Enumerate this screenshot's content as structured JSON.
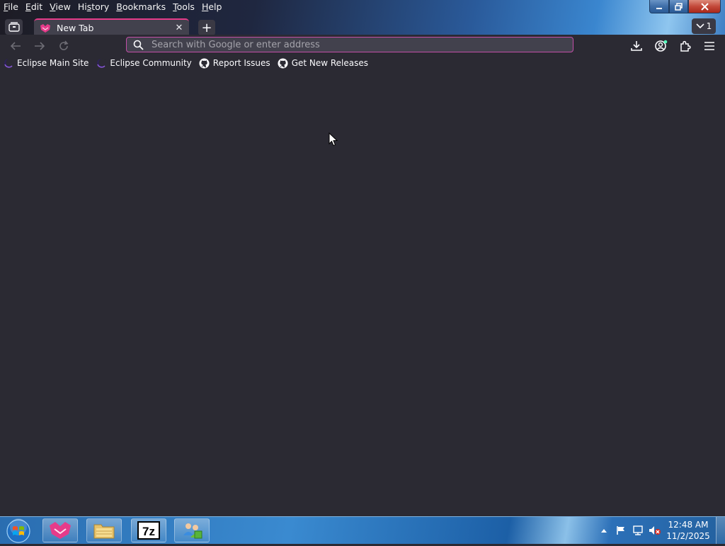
{
  "menubar": {
    "items": [
      {
        "accel": "F",
        "rest": "ile"
      },
      {
        "accel": "E",
        "rest": "dit"
      },
      {
        "accel": "V",
        "rest": "iew"
      },
      {
        "accel": "",
        "pre": "Hi",
        "accel2": "s",
        "rest": "tory"
      },
      {
        "accel": "B",
        "rest": "ookmarks"
      },
      {
        "accel": "T",
        "rest": "ools"
      },
      {
        "accel": "H",
        "rest": "elp"
      }
    ]
  },
  "window_controls": {
    "minimize_icon": "minimize-icon",
    "restore_icon": "restore-icon",
    "close_icon": "close-icon"
  },
  "tabs": [
    {
      "title": "New Tab",
      "favicon": "browser-logo-icon",
      "active": true
    }
  ],
  "tab_list": {
    "count": "1"
  },
  "navbar": {
    "search_placeholder": "Search with Google or enter address"
  },
  "bookmarks": [
    {
      "label": "Eclipse Main Site",
      "icon": "eclipse-icon"
    },
    {
      "label": "Eclipse Community",
      "icon": "eclipse-icon"
    },
    {
      "label": "Report Issues",
      "icon": "github-icon"
    },
    {
      "label": "Get New Releases",
      "icon": "github-icon"
    }
  ],
  "taskbar": {
    "apps": [
      {
        "name": "browser",
        "icon": "browser-logo-icon"
      },
      {
        "name": "file-explorer",
        "icon": "folder-icon"
      },
      {
        "name": "7zip",
        "icon": "7zip-icon",
        "label": "7z"
      },
      {
        "name": "network",
        "icon": "users-icon"
      }
    ],
    "clock": {
      "time": "12:48 AM",
      "date": "11/2/2025"
    }
  },
  "colors": {
    "accent": "#e63b8a",
    "url_border": "#c24ea8",
    "background": "#2b2a33",
    "toolbar": "#42414d"
  }
}
